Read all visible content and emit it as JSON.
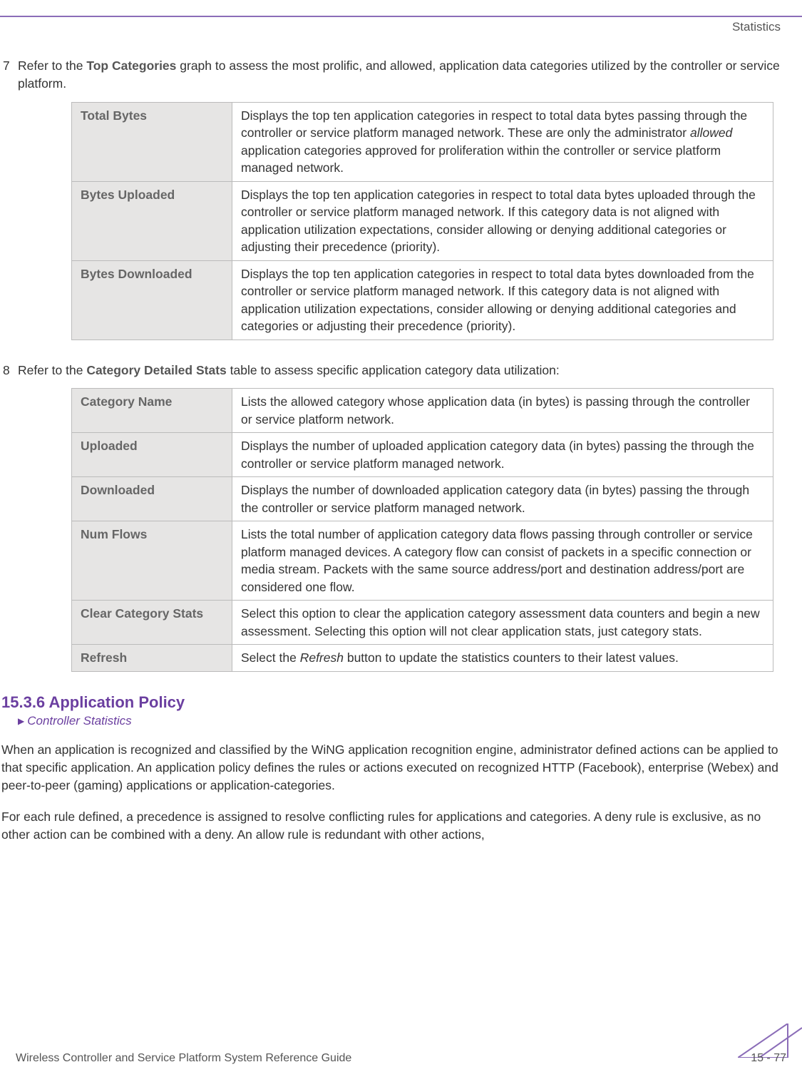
{
  "header": {
    "section_label": "Statistics"
  },
  "step7": {
    "num": "7",
    "text_pre": "Refer to the ",
    "text_bold": "Top Categories",
    "text_post": " graph to assess the most prolific, and allowed, application data categories utilized by the controller or service platform.",
    "rows": [
      {
        "term": "Total Bytes",
        "desc_pre": "Displays the top ten application categories in respect to total data bytes passing through the controller or service platform managed network. These are only the administrator ",
        "desc_italic": "allowed",
        "desc_post": " application categories approved for proliferation within the controller or service platform managed network."
      },
      {
        "term": "Bytes Uploaded",
        "desc": "Displays the top ten application categories in respect to total data bytes uploaded through the controller or service platform managed network. If this category data is not aligned with application utilization expectations, consider allowing or denying additional categories or adjusting their precedence (priority)."
      },
      {
        "term": "Bytes Downloaded",
        "desc": "Displays the top ten application categories in respect to total data bytes downloaded from the controller or service platform managed network. If this category data is not aligned with application utilization expectations, consider allowing or denying additional categories and categories or adjusting their precedence (priority)."
      }
    ]
  },
  "step8": {
    "num": "8",
    "text_pre": "Refer to the ",
    "text_bold": "Category Detailed Stats",
    "text_post": " table to assess specific application category data utilization:",
    "rows": [
      {
        "term": "Category Name",
        "desc": "Lists the allowed category whose application data (in bytes) is passing through the controller or service platform network."
      },
      {
        "term": "Uploaded",
        "desc": "Displays the number of uploaded application category data (in bytes) passing the through the controller or service platform managed network."
      },
      {
        "term": "Downloaded",
        "desc": "Displays the number of downloaded application category data (in bytes) passing the through the controller or service platform managed network."
      },
      {
        "term": "Num Flows",
        "desc": "Lists the total number of application category data flows passing through controller or service platform managed devices. A category flow can consist of packets in a specific connection or media stream. Packets with the same source address/port and destination address/port are considered one flow."
      },
      {
        "term": "Clear Category Stats",
        "desc": "Select this option to clear the application category assessment data counters and begin a new assessment. Selecting this option will not clear application stats, just category stats."
      },
      {
        "term": "Refresh",
        "desc_pre": "Select the ",
        "desc_italic": "Refresh",
        "desc_post": " button to update the statistics counters to their latest values."
      }
    ]
  },
  "section": {
    "heading": "15.3.6 Application Policy",
    "breadcrumb": "Controller Statistics",
    "p1": "When an application is recognized and classified by the WiNG application recognition engine, administrator defined actions can be applied to that specific application. An application policy defines the rules or actions executed on recognized HTTP (Facebook), enterprise (Webex) and peer-to-peer (gaming) applications or application-categories.",
    "p2": "For each rule defined, a precedence is assigned to resolve conflicting rules for applications and categories. A deny rule is exclusive, as no other action can be combined with a deny. An allow rule is redundant with other actions,"
  },
  "footer": {
    "left": "Wireless Controller and Service Platform System Reference Guide",
    "right": "15 - 77"
  }
}
